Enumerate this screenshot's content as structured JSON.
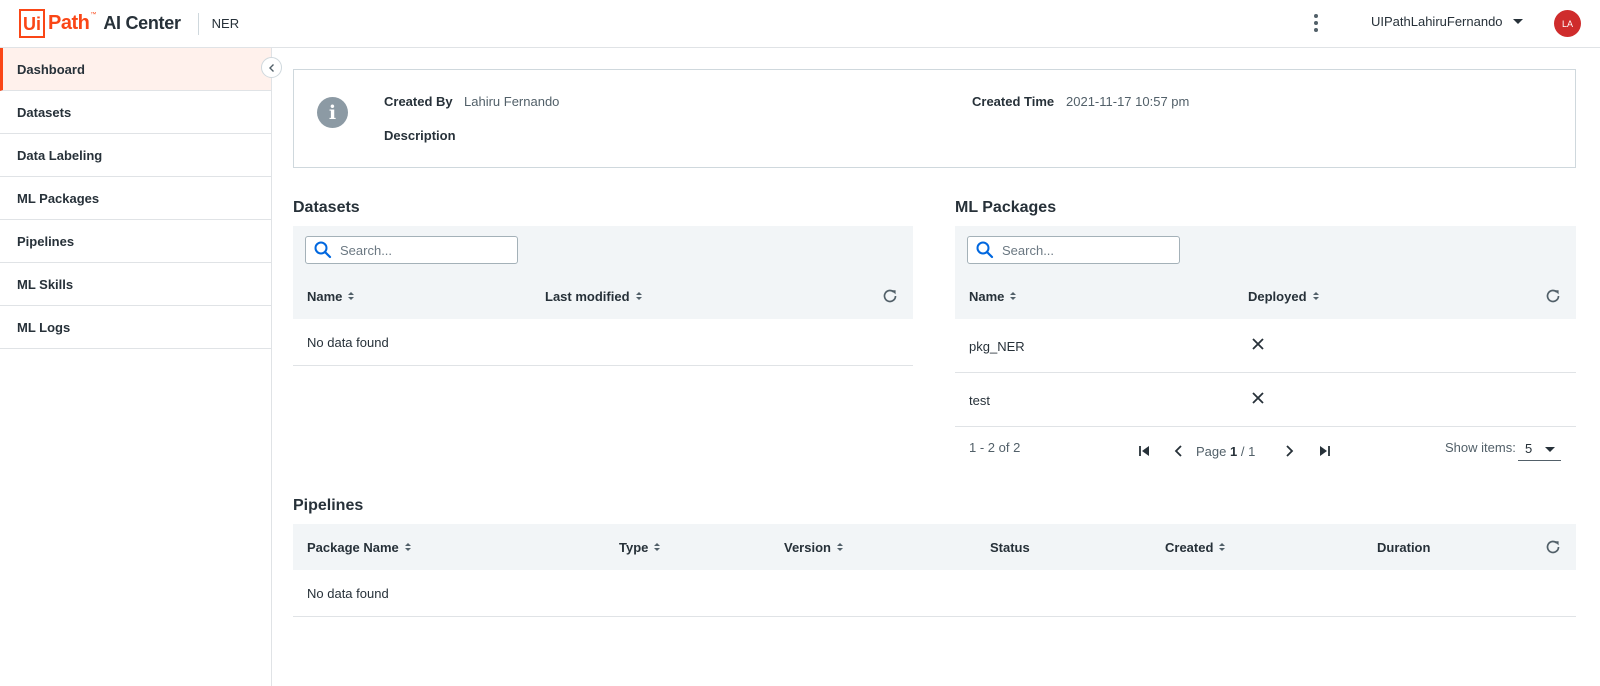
{
  "header": {
    "logo_ui": "Ui",
    "logo_path": "Path",
    "logo_tm": "™",
    "logo_product": "AI Center",
    "project": "NER",
    "user": "UIPathLahiruFernando",
    "avatar_initials": "LA",
    "brand_color": "#fa4616"
  },
  "sidebar": {
    "items": [
      {
        "label": "Dashboard",
        "active": true
      },
      {
        "label": "Datasets"
      },
      {
        "label": "Data Labeling"
      },
      {
        "label": "ML Packages"
      },
      {
        "label": "Pipelines"
      },
      {
        "label": "ML Skills"
      },
      {
        "label": "ML Logs"
      }
    ]
  },
  "info": {
    "icon": "i",
    "created_by_label": "Created By",
    "created_by_value": "Lahiru Fernando",
    "description_label": "Description",
    "created_time_label": "Created Time",
    "created_time_value": "2021-11-17 10:57 pm"
  },
  "datasets": {
    "title": "Datasets",
    "search_placeholder": "Search...",
    "columns": [
      "Name",
      "Last modified"
    ],
    "empty": "No data found"
  },
  "ml_packages": {
    "title": "ML Packages",
    "search_placeholder": "Search...",
    "columns": [
      "Name",
      "Deployed"
    ],
    "rows": [
      {
        "name": "pkg_NER",
        "deployed": false
      },
      {
        "name": "test",
        "deployed": false
      }
    ],
    "pager": {
      "range": "1 - 2 of 2",
      "page_label": "Page",
      "current": "1",
      "separator": "/",
      "total": "1",
      "show_items_label": "Show items:",
      "show_items_value": "5"
    }
  },
  "pipelines": {
    "title": "Pipelines",
    "columns": [
      "Package Name",
      "Type",
      "Version",
      "Status",
      "Created",
      "Duration"
    ],
    "empty": "No data found"
  }
}
